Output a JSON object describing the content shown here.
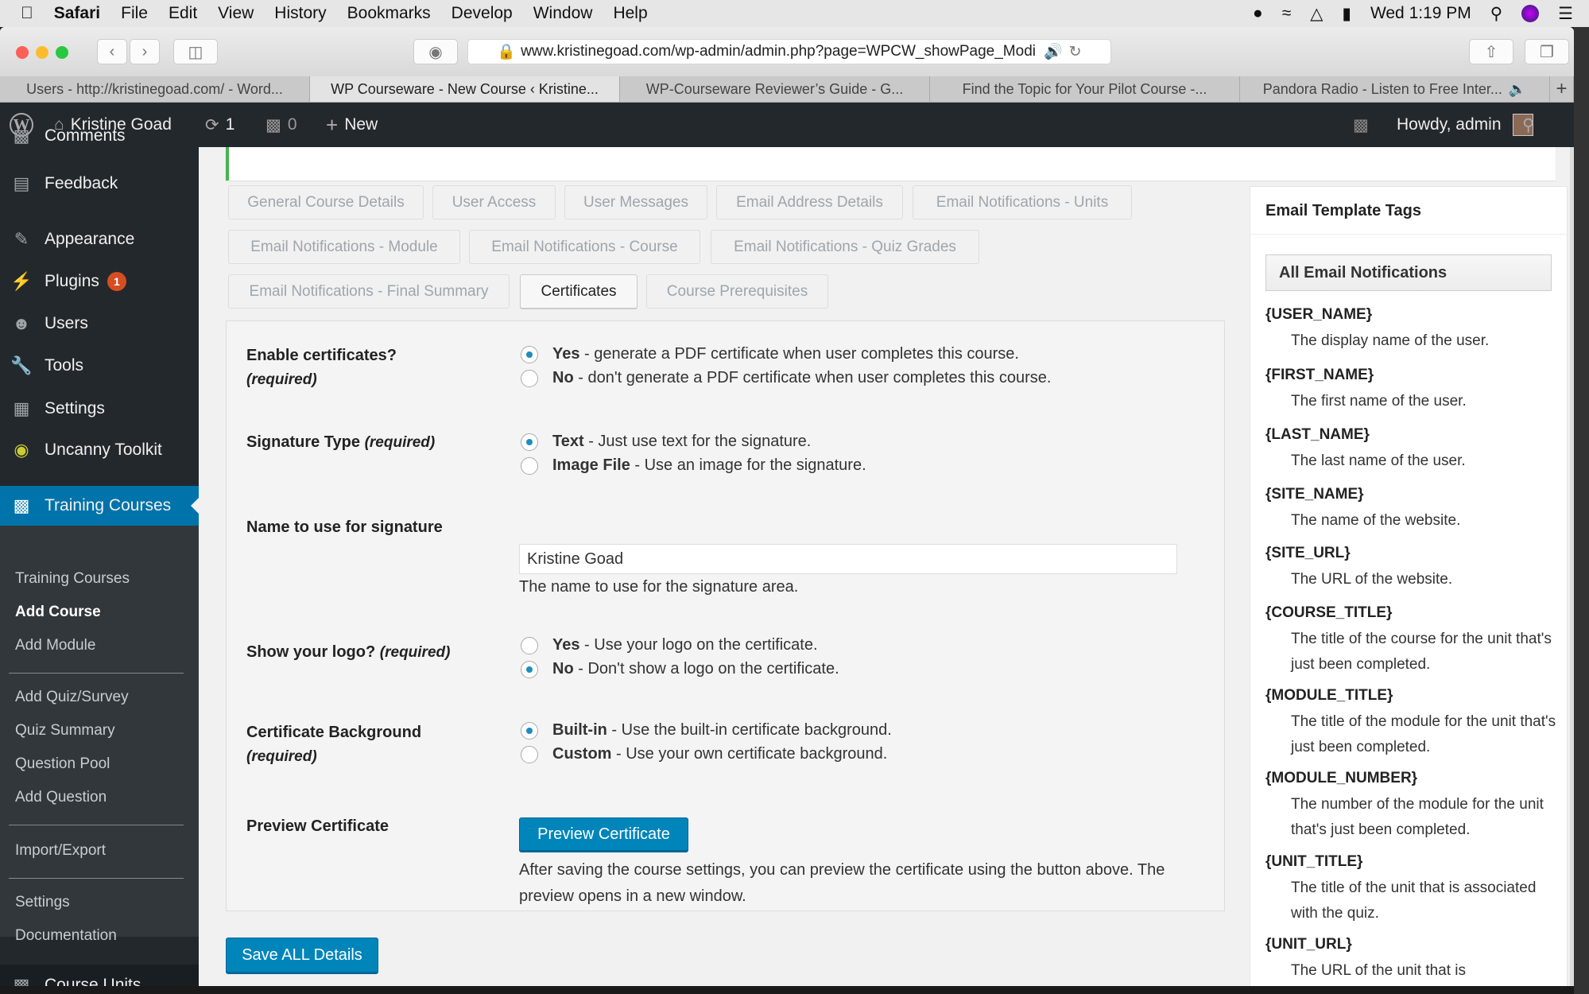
{
  "mac_menu": {
    "apple_icon": "apple-icon",
    "app": "Safari",
    "items": [
      "File",
      "Edit",
      "View",
      "History",
      "Bookmarks",
      "Develop",
      "Window",
      "Help"
    ],
    "clock": "Wed 1:19 PM"
  },
  "browser": {
    "url": "www.kristinegoad.com/wp-admin/admin.php?page=WPCW_showPage_Modi",
    "tabs": [
      "Users - http://kristinegoad.com/ - Word...",
      "WP Courseware - New Course ‹ Kristine...",
      "WP-Courseware Reviewer’s Guide - G...",
      "Find the Topic for Your Pilot Course -...",
      "Pandora Radio - Listen to Free Inter..."
    ],
    "active_tab": 1
  },
  "adminbar": {
    "site": "Kristine Goad",
    "updates": "1",
    "comments": "0",
    "new": "New",
    "howdy": "Howdy, admin"
  },
  "sidebar": {
    "items": [
      {
        "label": "Comments",
        "icon": "comment-icon"
      },
      {
        "label": "Feedback",
        "icon": "feedback-icon"
      },
      {
        "label": "Appearance",
        "icon": "paintbrush-icon"
      },
      {
        "label": "Plugins",
        "icon": "plugin-icon",
        "badge": "1"
      },
      {
        "label": "Users",
        "icon": "user-icon"
      },
      {
        "label": "Tools",
        "icon": "wrench-icon"
      },
      {
        "label": "Settings",
        "icon": "settings-icon"
      },
      {
        "label": "Uncanny Toolkit",
        "icon": "uncanny-icon"
      },
      {
        "label": "Training Courses",
        "icon": "chalkboard-icon"
      },
      {
        "label": "Course Units",
        "icon": "chalkboard-icon"
      }
    ],
    "submenu": [
      "Training Courses",
      "Add Course",
      "Add Module",
      "Add Quiz/Survey",
      "Quiz Summary",
      "Question Pool",
      "Add Question",
      "Import/Export",
      "Settings",
      "Documentation"
    ],
    "current_sub": "Add Course"
  },
  "tabs": [
    "General Course Details",
    "User Access",
    "User Messages",
    "Email Address Details",
    "Email Notifications - Units",
    "Email Notifications - Module",
    "Email Notifications - Course",
    "Email Notifications - Quiz Grades",
    "Email Notifications - Final Summary",
    "Certificates",
    "Course Prerequisites"
  ],
  "active_tab": "Certificates",
  "form": {
    "enable": {
      "label": "Enable certificates?",
      "req": "(required)",
      "opt1_b": "Yes",
      "opt1": " - generate a PDF certificate when user completes this course.",
      "opt2_b": "No",
      "opt2": " - don't generate a PDF certificate when user completes this course.",
      "selected": "Yes"
    },
    "sigtype": {
      "label": "Signature Type",
      "req": "(required)",
      "opt1_b": "Text",
      "opt1": " - Just use text for the signature.",
      "opt2_b": "Image File",
      "opt2": " - Use an image for the signature.",
      "selected": "Text"
    },
    "signame": {
      "label": "Name to use for signature",
      "value": "Kristine Goad",
      "help": "The name to use for the signature area."
    },
    "logo": {
      "label": "Show your logo?",
      "req": "(required)",
      "opt1_b": "Yes",
      "opt1": " - Use your logo on the certificate.",
      "opt2_b": "No",
      "opt2": " - Don't show a logo on the certificate.",
      "selected": "No"
    },
    "bg": {
      "label": "Certificate Background",
      "req": "(required)",
      "opt1_b": "Built-in",
      "opt1": " - Use the built-in certificate background.",
      "opt2_b": "Custom",
      "opt2": " - Use your own certificate background.",
      "selected": "Built-in"
    },
    "preview": {
      "label": "Preview Certificate",
      "button": "Preview Certificate",
      "help": "After saving the course settings, you can preview the certificate using the button above. The preview opens in a new window."
    }
  },
  "save_button": "Save ALL Details",
  "right_panel": {
    "title": "Email Template Tags",
    "select": "All Email Notifications",
    "tags": [
      {
        "name": "{USER_NAME}",
        "desc": "The display name of the user."
      },
      {
        "name": "{FIRST_NAME}",
        "desc": "The first name of the user."
      },
      {
        "name": "{LAST_NAME}",
        "desc": "The last name of the user."
      },
      {
        "name": "{SITE_NAME}",
        "desc": "The name of the website."
      },
      {
        "name": "{SITE_URL}",
        "desc": "The URL of the website."
      },
      {
        "name": "{COURSE_TITLE}",
        "desc": "The title of the course for the unit that's just been completed."
      },
      {
        "name": "{MODULE_TITLE}",
        "desc": "The title of the module for the unit that's just been completed."
      },
      {
        "name": "{MODULE_NUMBER}",
        "desc": "The number of the module for the unit that's just been completed."
      },
      {
        "name": "{UNIT_TITLE}",
        "desc": "The title of the unit that is associated with the quiz."
      },
      {
        "name": "{UNIT_URL}",
        "desc": "The URL of the unit that is"
      }
    ]
  },
  "colors": {
    "wp_blue": "#0085ba",
    "admin_dark": "#23282d",
    "menu_active": "#0073aa",
    "badge": "#d54e21"
  }
}
